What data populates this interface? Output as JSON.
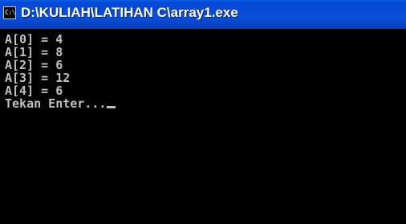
{
  "window": {
    "title": "D:\\KULIAH\\LATIHAN C\\array1.exe",
    "icon": "console-icon",
    "icon_text": "C:\\"
  },
  "console": {
    "lines": [
      "A[0] = 4",
      "A[1] = 8",
      "A[2] = 6",
      "A[3] = 12",
      "A[4] = 6"
    ],
    "prompt": "Tekan Enter...",
    "text_color": "#c0c0c0",
    "background": "#000000"
  }
}
